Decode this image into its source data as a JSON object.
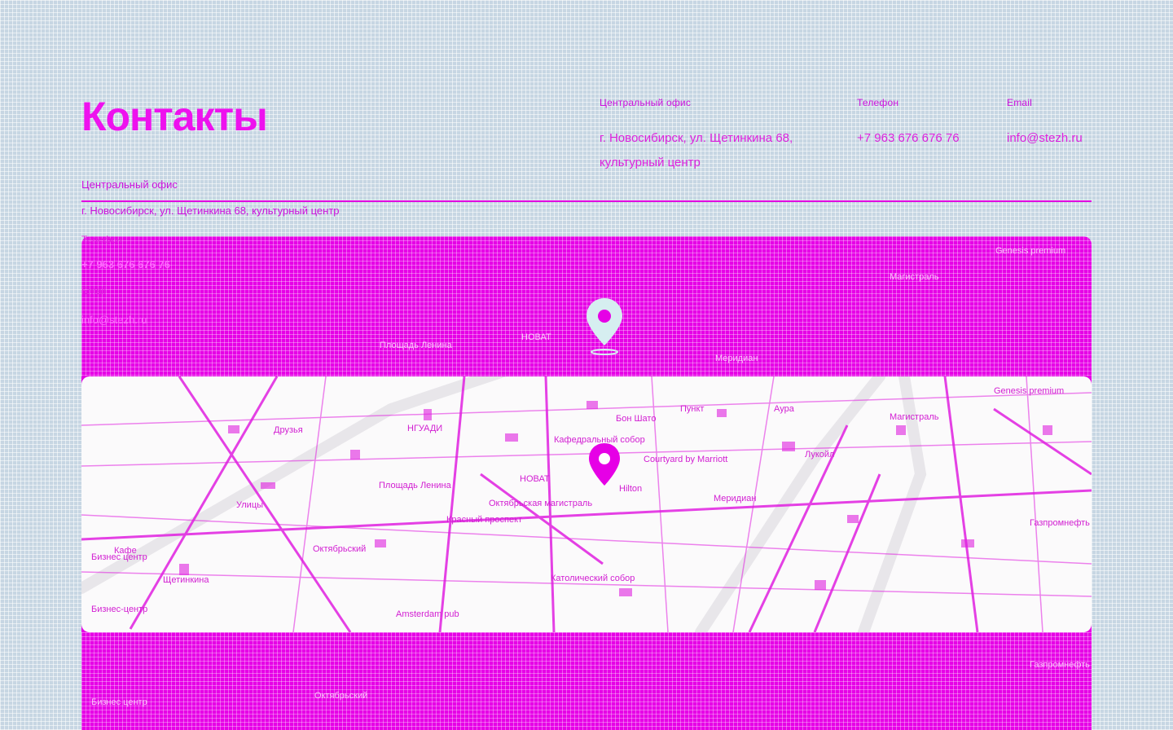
{
  "page": {
    "title": "Контакты"
  },
  "contacts": {
    "address_label": "Центральный офис",
    "address_value": "г. Новосибирск, ул. Щетинкина 68, культурный центр",
    "phone_label": "Телефон",
    "phone_value": "+7 963 676 676 76",
    "email_label": "Email",
    "email_value": "info@stezh.ru"
  },
  "office": {
    "title": "Центральный офис",
    "address": "г. Новосибирск, ул. Щетинкина 68, культурный центр",
    "phone_label": "Телефон",
    "phone": "+7 963 676 676 76",
    "email_label": "Email",
    "email": "info@stezh.ru"
  },
  "map": {
    "pin_icon": "map-pin-icon",
    "accent": "#e600e6",
    "land": "#fbfafb",
    "places": [
      "Genesis premium",
      "Магистраль",
      "Пункт",
      "Бон Шато",
      "Кафедральный собор",
      "Аура",
      "Друзья",
      "НГУАДИ",
      "Улицы",
      "Площадь Ленина",
      "НОВАТ",
      "Courtyard by Marriott",
      "Hilton",
      "Меридиан",
      "Лукойл",
      "Газпромнефть",
      "Октябрьский",
      "Бизнес центр",
      "Щетинкина",
      "Amsterdam pub",
      "Красный проспект",
      "Октябрьская магистраль",
      "Кафе",
      "Католический собор",
      "Бизнес-центр"
    ]
  }
}
